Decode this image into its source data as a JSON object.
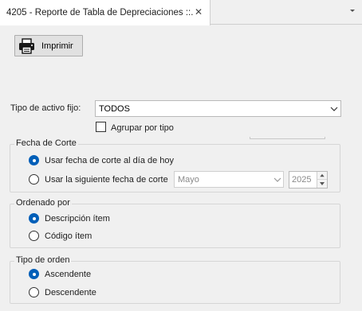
{
  "tab": {
    "title": "4205 - Reporte de Tabla de Depreciaciones ::.",
    "close_glyph": "✕"
  },
  "toolbar": {
    "print_label": "Imprimir",
    "print_icon": "printer-icon"
  },
  "asset_type": {
    "label": "Tipo de activo fijo:",
    "selected": "TODOS",
    "group_by_label": "Agrupar por tipo",
    "group_by_checked": false
  },
  "cutoff": {
    "title": "Fecha de Corte",
    "option_today": "Usar fecha de corte al día de hoy",
    "option_custom": "Usar la siguiente fecha de corte",
    "selected": "today",
    "month": "Mayo",
    "year": "2025"
  },
  "order_by": {
    "title": "Ordenado por",
    "option_description": "Descripción ítem",
    "option_code": "Código ítem",
    "selected": "description"
  },
  "sort_order": {
    "title": "Tipo de orden",
    "option_asc": "Ascendente",
    "option_desc": "Descendente",
    "selected": "asc"
  },
  "colors": {
    "accent": "#005fb8",
    "background": "#f0f0f0",
    "border": "#d6d6d6"
  }
}
